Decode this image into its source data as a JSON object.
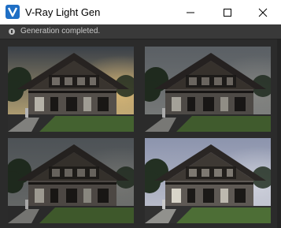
{
  "window": {
    "title": "V-Ray Light Gen",
    "icon": "vray-logo-icon",
    "controls": [
      "minimize-icon",
      "maximize-icon",
      "close-icon"
    ]
  },
  "status": {
    "icon": "info-icon",
    "text": "Generation completed."
  },
  "gallery": {
    "thumbnails": [
      {
        "name": "thumbnail-sunset",
        "sky_top": "#3a4048",
        "sky_bottom": "#c9b27a",
        "glow": "#e8c27a",
        "brightness": 0.55
      },
      {
        "name": "thumbnail-overcast",
        "sky_top": "#5a5f64",
        "sky_bottom": "#7c7e7c",
        "glow": "#8a8a86",
        "brightness": 0.45
      },
      {
        "name": "thumbnail-dusk",
        "sky_top": "#4d5256",
        "sky_bottom": "#6a6c6a",
        "glow": "#7a7a76",
        "brightness": 0.4
      },
      {
        "name": "thumbnail-daylight",
        "sky_top": "#8c94ad",
        "sky_bottom": "#c3c5d0",
        "glow": "#d7d9e2",
        "brightness": 0.75
      }
    ]
  },
  "colors": {
    "accent": "#1f6fc5",
    "titlebar": "#ffffff",
    "background": "#2b2b2b"
  }
}
